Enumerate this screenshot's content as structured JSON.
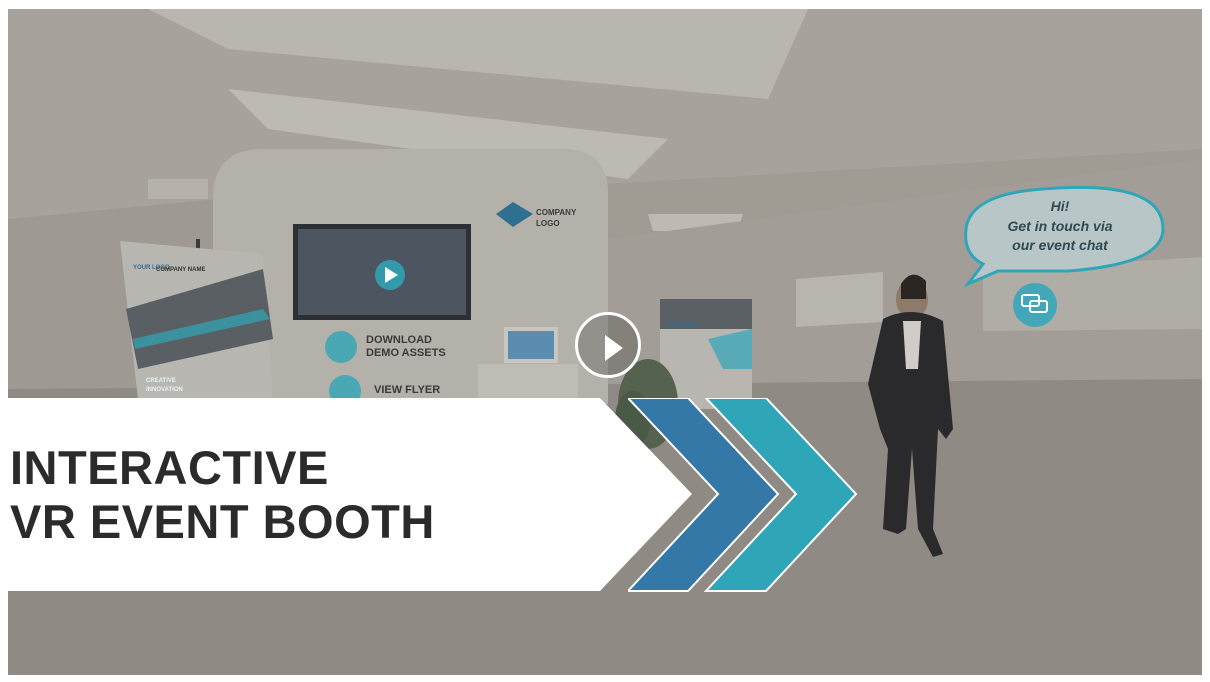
{
  "video": {
    "title_line1": "INTERACTIVE",
    "title_line2": "VR EVENT BOOTH",
    "play_icon": "play-icon"
  },
  "booth": {
    "logo_text_line1": "COMPANY",
    "logo_text_line2": "LOGO",
    "download_line1": "DOWNLOAD",
    "download_line2": "DEMO ASSETS",
    "view_flyer": "VIEW FLYER",
    "left_banner_company": "COMPANY NAME",
    "left_banner_logo": "YOUR LOGO",
    "left_banner_tagline1": "CREATIVE",
    "left_banner_tagline2": "INNOVATION",
    "right_banner_headline": "HEADLINE"
  },
  "chat_bubble": {
    "line1": "Hi!",
    "line2": "Get in touch via",
    "line3": "our event chat"
  },
  "colors": {
    "accent_teal": "#2fa6b8",
    "accent_blue": "#3478a8",
    "text_dark": "#2b2b2b"
  }
}
